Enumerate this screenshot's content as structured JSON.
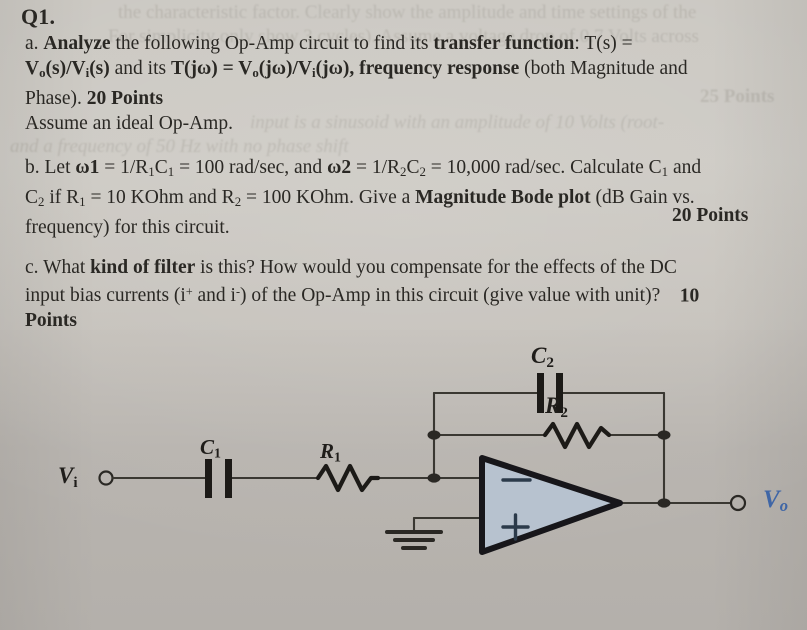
{
  "document": {
    "question_number": "Q1.",
    "parts": [
      {
        "id": "a",
        "label": "a.",
        "lines": [
          {
            "segments": [
              {
                "text": "Analyze",
                "bold": true
              },
              {
                "text": " the following Op-Amp circuit to find its ",
                "bold": false
              },
              {
                "text": "transfer function",
                "bold": true
              },
              {
                "text": ": T(s) =",
                "bold": false
              }
            ]
          },
          {
            "segments": [
              {
                "text": "V",
                "bold": true
              },
              {
                "text": "o",
                "sub": true,
                "bold": true
              },
              {
                "text": "(s)/V",
                "bold": true
              },
              {
                "text": "i",
                "sub": true,
                "bold": true
              },
              {
                "text": "(s)",
                "bold": true
              },
              {
                "text": " and its ",
                "bold": false
              },
              {
                "text": "T(jω) = V",
                "bold": true
              },
              {
                "text": "o",
                "sub": true,
                "bold": true
              },
              {
                "text": "(jω)/V",
                "bold": true
              },
              {
                "text": "i",
                "sub": true,
                "bold": true
              },
              {
                "text": "(jω), frequency response",
                "bold": true
              },
              {
                "text": " (both Magnitude and",
                "bold": false
              }
            ]
          },
          {
            "segments": [
              {
                "text": "Phase). ",
                "bold": false
              },
              {
                "text": "20 Points",
                "bold": true
              }
            ]
          },
          {
            "segments": [
              {
                "text": "Assume an ideal Op-Amp.",
                "bold": false
              }
            ]
          }
        ]
      },
      {
        "id": "b",
        "label": "b.",
        "lines": [
          {
            "segments": [
              {
                "text": "b. Let ",
                "bold": false
              },
              {
                "text": "ω1",
                "bold": true
              },
              {
                "text": " = 1/R",
                "bold": false
              },
              {
                "text": "1",
                "sub": true
              },
              {
                "text": "C",
                "bold": false
              },
              {
                "text": "1",
                "sub": true
              },
              {
                "text": " = 100 rad/sec, and ",
                "bold": false
              },
              {
                "text": "ω2",
                "bold": true
              },
              {
                "text": " = 1/R",
                "bold": false
              },
              {
                "text": "2",
                "sub": true
              },
              {
                "text": "C",
                "bold": false
              },
              {
                "text": "2",
                "sub": true
              },
              {
                "text": " = 10,000 rad/sec. Calculate C",
                "bold": false
              },
              {
                "text": "1",
                "sub": true
              },
              {
                "text": " and",
                "bold": false
              }
            ]
          },
          {
            "segments": [
              {
                "text": "C",
                "bold": false
              },
              {
                "text": "2",
                "sub": true
              },
              {
                "text": " if R",
                "bold": false
              },
              {
                "text": "1",
                "sub": true
              },
              {
                "text": " = 10 KOhm and R",
                "bold": false
              },
              {
                "text": "2",
                "sub": true
              },
              {
                "text": " = 100 KOhm. Give a ",
                "bold": false
              },
              {
                "text": "Magnitude Bode plot",
                "bold": true
              },
              {
                "text": " (dB Gain vs.",
                "bold": false
              }
            ]
          },
          {
            "segments": [
              {
                "text": "frequency) for this circuit.",
                "bold": false
              }
            ],
            "trailing_points": "20 Points"
          }
        ]
      },
      {
        "id": "c",
        "label": "c.",
        "lines": [
          {
            "segments": [
              {
                "text": "c. ",
                "bold": false
              },
              {
                "text": "What ",
                "bold": false
              },
              {
                "text": "kind of filter",
                "bold": true
              },
              {
                "text": " is this? How would you compensate for the effects of the DC",
                "bold": false
              }
            ]
          },
          {
            "segments": [
              {
                "text": "input bias currents (i",
                "bold": false
              },
              {
                "text": "+",
                "sup": true
              },
              {
                "text": " and i",
                "bold": false
              },
              {
                "text": "-",
                "sup": true
              },
              {
                "text": ") of the Op-Amp in this circuit (give value with unit)?",
                "bold": false
              },
              {
                "text": "     10",
                "bold": true
              }
            ]
          },
          {
            "segments": [
              {
                "text": "Points",
                "bold": true
              }
            ]
          }
        ]
      }
    ]
  },
  "text_lines": {
    "q1": "Q1.",
    "a_l1_pre": "a.",
    "a_l1_b1": "Analyze",
    "a_l1_m1": " the following Op-Amp circuit to find its ",
    "a_l1_b2": "transfer function",
    "a_l1_m2": ": T(s)  =",
    "a_l3_m": "Phase). ",
    "a_l3_b": "20 Points",
    "a_l4": "Assume an ideal Op-Amp.",
    "b_l3_m": "frequency) for this circuit.",
    "b_l3_points": "20 Points",
    "c_l3": "Points"
  },
  "ghost_lines": [
    "the characteristic factor. Clearly show the amplitude and time settings of the",
    "For simplicity only show 3 cycles). Assume a voltage drop of 0.7 Volts across",
    "25 Points",
    "input is a sinusoid with an amplitude of 10 Volts (root-",
    "and a frequency of 50 Hz with no phase shift"
  ],
  "circuit": {
    "labels": {
      "vin": "V",
      "vin_sub": "i",
      "vout": "V",
      "vout_sub": "o",
      "c1": "C",
      "c1_sub": "1",
      "r1": "R",
      "r1_sub": "1",
      "c2": "C",
      "c2_sub": "2",
      "r2": "R",
      "r2_sub": "2",
      "opamp_minus": "−",
      "opamp_plus": "+"
    },
    "colors": {
      "wire": "#3a3832",
      "opamp_fill": "#b7c2cf",
      "opamp_stroke": "#17161a",
      "component": "#1c1a17",
      "vout_label": "#3f66a6"
    },
    "description": "Inverting op-amp band-pass filter: Vi through series C1 then R1 into the inverting input node; feedback network of R2 in parallel with C2 from output back to inverting input; non-inverting input tied to ground; output node labeled Vo."
  },
  "colors": {
    "paper_light": "#cdcac4",
    "paper_dark": "#b4b0ab",
    "ink": "#2a2824",
    "ghost_ink": "rgba(110,104,96,0.20)",
    "blue_ink": "#3f66a6"
  }
}
